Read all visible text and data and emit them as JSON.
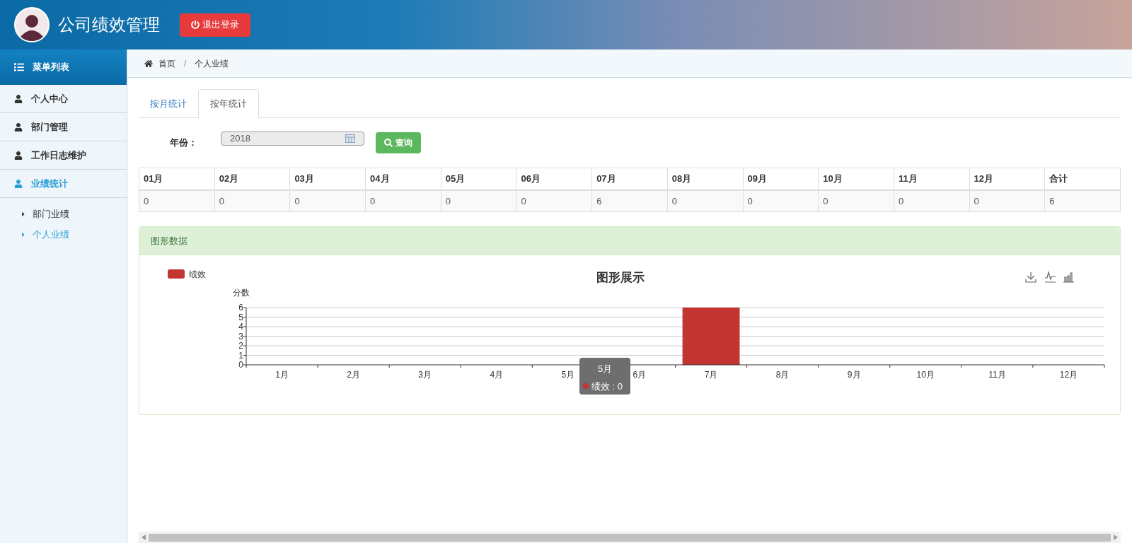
{
  "header": {
    "title": "公司绩效管理",
    "logout_button": "退出登录"
  },
  "sidebar": {
    "title": "菜单列表",
    "items": [
      {
        "label": "个人中心",
        "selected": false
      },
      {
        "label": "部门管理",
        "selected": false
      },
      {
        "label": "工作日志维护",
        "selected": false
      },
      {
        "label": "业绩统计",
        "selected": true,
        "expanded": true,
        "children": [
          {
            "label": "部门业绩",
            "selected": false
          },
          {
            "label": "个人业绩",
            "selected": true
          }
        ]
      }
    ]
  },
  "breadcrumb": {
    "separator": "/",
    "items": [
      "首页",
      "个人业绩"
    ]
  },
  "tabs": [
    {
      "label": "按月统计",
      "selected": false
    },
    {
      "label": "按年统计",
      "selected": true
    }
  ],
  "filter": {
    "label": "年份：",
    "value": "2018",
    "button": "查询"
  },
  "table": {
    "columns": [
      "01月",
      "02月",
      "03月",
      "04月",
      "05月",
      "06月",
      "07月",
      "08月",
      "09月",
      "10月",
      "11月",
      "12月",
      "合计"
    ],
    "rows": [
      [
        "0",
        "0",
        "0",
        "0",
        "0",
        "0",
        "6",
        "0",
        "0",
        "0",
        "0",
        "0",
        "6"
      ]
    ]
  },
  "panel": {
    "title": "图形数据",
    "chart_data": {
      "type": "bar",
      "title": "图形展示",
      "ylabel": "分数",
      "categories": [
        "1月",
        "2月",
        "3月",
        "4月",
        "5月",
        "6月",
        "7月",
        "8月",
        "9月",
        "10月",
        "11月",
        "12月"
      ],
      "series": [
        {
          "name": "绩效",
          "color": "#c23531",
          "values": [
            0,
            0,
            0,
            0,
            0,
            0,
            6,
            0,
            0,
            0,
            0,
            0
          ]
        }
      ],
      "yticks": [
        0,
        1,
        2,
        3,
        4,
        5,
        6
      ],
      "ylim": [
        0,
        6
      ],
      "grid": true
    },
    "tooltip": {
      "title": "5月",
      "text": "绩效 : 0"
    }
  }
}
